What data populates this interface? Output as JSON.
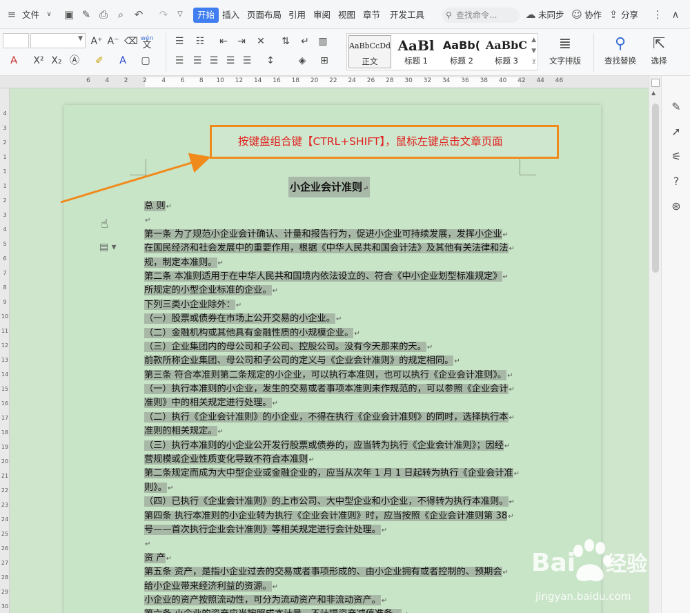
{
  "menubar": {
    "file_label": "文件",
    "tabs": [
      {
        "label": "开始",
        "active": true
      },
      {
        "label": "插入"
      },
      {
        "label": "页面布局"
      },
      {
        "label": "引用"
      },
      {
        "label": "审阅"
      },
      {
        "label": "视图"
      },
      {
        "label": "章节"
      },
      {
        "label": "开发工具"
      }
    ],
    "search_placeholder": "查找命令...",
    "sync_label": "未同步",
    "collab_label": "协作",
    "share_label": "分享"
  },
  "ribbon": {
    "styles": [
      {
        "preview": "AaBbCcDd",
        "label": "正文"
      },
      {
        "preview": "AaBl",
        "label": "标题 1"
      },
      {
        "preview": "AaBb(",
        "label": "标题 2"
      },
      {
        "preview": "AaBbC",
        "label": "标题 3"
      }
    ],
    "text_layout_label": "文字排版",
    "find_replace_label": "查找替换",
    "select_label": "选择",
    "wen_label": "wén",
    "wen_char": "文"
  },
  "ruler": {
    "ticks": [
      "6",
      "4",
      "2",
      "2",
      "4",
      "6",
      "8",
      "10",
      "12",
      "14",
      "16",
      "18",
      "20",
      "22",
      "24",
      "26",
      "28",
      "30",
      "32",
      "34",
      "36",
      "38",
      "40",
      "42",
      "44",
      "46"
    ],
    "vticks": [
      "4",
      "3",
      "2",
      "1",
      "1",
      "1",
      "2",
      "3",
      "4",
      "5",
      "6",
      "7",
      "8",
      "9",
      "10",
      "11",
      "12",
      "13",
      "14",
      "15",
      "16",
      "17",
      "18",
      "19",
      "20",
      "21",
      "22",
      "23",
      "24",
      "25",
      "26",
      "27",
      "28",
      "29",
      "30",
      "31"
    ]
  },
  "callout": {
    "text": "按键盘组合键【CTRL+SHIFT】，鼠标左键点击文章页面"
  },
  "document": {
    "title": "小企业会计准则",
    "lines": [
      "总 则",
      "",
      "第一条 为了规范小企业会计确认、计量和报告行为，促进小企业可持续发展，发挥小企业",
      "在国民经济和社会发展中的重要作用，根据《中华人民共和国会计法》及其他有关法律和法",
      "规，制定本准则。",
      "第二条 本准则适用于在中华人民共和国境内依法设立的、符合《中小企业划型标准规定》",
      "所规定的小型企业标准的企业。",
      "下列三类小企业除外：",
      "（一）股票或债券在市场上公开交易的小企业。",
      "（二）金融机构或其他具有金融性质的小规模企业。",
      "（三）企业集团内的母公司和子公司、控股公司。没有今天那来的天。",
      "前款所称企业集团、母公司和子公司的定义与《企业会计准则》的规定相同。",
      "第三条 符合本准则第二条规定的小企业，可以执行本准则，也可以执行《企业会计准则》。",
      "（一）执行本准则的小企业，发生的交易或者事项本准则未作规范的，可以参照《企业会计",
      "准则》中的相关规定进行处理。",
      "（二）执行《企业会计准则》的小企业，不得在执行《企业会计准则》的同时，选择执行本",
      "准则的相关规定。",
      "（三）执行本准则的小企业公开发行股票或债券的，应当转为执行《企业会计准则》；因经",
      "营规模或企业性质变化导致不符合本准则",
      "第二条规定而成为大中型企业或金融企业的，应当从次年 1 月 1 日起转为执行《企业会计准",
      "则》。",
      "（四）已执行《企业会计准则》的上市公司、大中型企业和小企业，不得转为执行本准则。",
      "第四条 执行本准则的小企业转为执行《企业会计准则》时，应当按照《企业会计准则第 38",
      "号——首次执行企业会计准则》等相关规定进行会计处理。",
      "",
      "资 产",
      "第五条 资产，是指小企业过去的交易或者事项形成的、由小企业拥有或者控制的、预期会",
      "给小企业带来经济利益的资源。",
      "小企业的资产按照流动性，可分为流动资产和非流动资产。",
      "第六条 小企业的资产应当按照成本计量，不计提资产减值准备。"
    ]
  },
  "watermark": {
    "brand": "Bai",
    "brand2": "经验",
    "sub": "jingyan.baidu.com"
  },
  "colors": {
    "accent": "#3f7df0",
    "callout_border": "#f08a1c",
    "callout_text": "#e0201f",
    "page_bg": "#c9e5c8",
    "selection": "#a8b8a6"
  }
}
